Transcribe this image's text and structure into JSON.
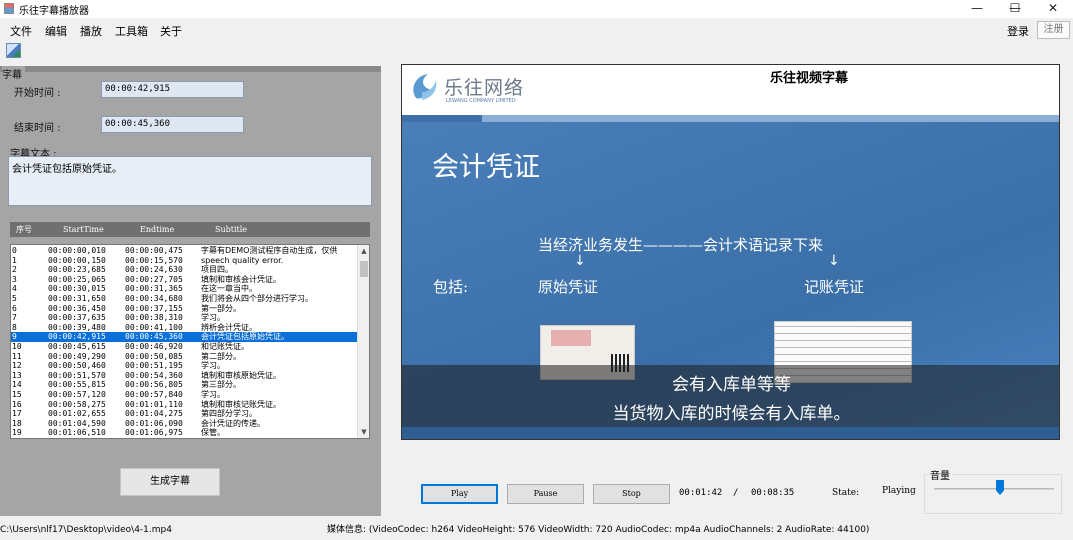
{
  "window": {
    "title": "乐往字幕播放器",
    "controls": [
      "—",
      "☐",
      "✕"
    ]
  },
  "menu": [
    "文件",
    "编辑",
    "播放",
    "工具箱",
    "关于"
  ],
  "auth": {
    "login": "登录",
    "register": "注册"
  },
  "subtitle_panel": {
    "group_label": "字幕",
    "start_label": "开始时间 :",
    "start_value": "00:00:42,915",
    "end_label": "结束时间 :",
    "end_value": "00:00:45,360",
    "text_label": "字幕文本 :",
    "text_value": "会计凭证包括原始凭证。"
  },
  "list": {
    "columns": [
      "序号",
      "StartTime",
      "Endtime",
      "Subtitle"
    ],
    "selected_index": 9,
    "rows": [
      [
        "0",
        "00:00:00,010",
        "00:00:00,475",
        "字幕有DEMO测试程序自动生成，仅供"
      ],
      [
        "1",
        "00:00:00,150",
        "00:00:15,570",
        "speech quality error."
      ],
      [
        "2",
        "00:00:23,685",
        "00:00:24,630",
        "项目四。"
      ],
      [
        "3",
        "00:00:25,065",
        "00:00:27,705",
        "填制和审核会计凭证。"
      ],
      [
        "4",
        "00:00:30,015",
        "00:00:31,365",
        "在这一章当中。"
      ],
      [
        "5",
        "00:00:31,650",
        "00:00:34,680",
        "我们将会从四个部分进行学习。"
      ],
      [
        "6",
        "00:00:36,450",
        "00:00:37,155",
        "第一部分。"
      ],
      [
        "7",
        "00:00:37,635",
        "00:00:38,310",
        "学习。"
      ],
      [
        "8",
        "00:00:39,480",
        "00:00:41,100",
        "辨析会计凭证。"
      ],
      [
        "9",
        "00:00:42,915",
        "00:00:45,360",
        "会计凭证包括原始凭证。"
      ],
      [
        "10",
        "00:00:45,615",
        "00:00:46,920",
        "和记账凭证。"
      ],
      [
        "11",
        "00:00:49,290",
        "00:00:50,085",
        "第二部分。"
      ],
      [
        "12",
        "00:00:50,460",
        "00:00:51,195",
        "学习。"
      ],
      [
        "13",
        "00:00:51,570",
        "00:00:54,360",
        "填制和审核原始凭证。"
      ],
      [
        "14",
        "00:00:55,815",
        "00:00:56,805",
        "第三部分。"
      ],
      [
        "15",
        "00:00:57,120",
        "00:00:57,840",
        "学习。"
      ],
      [
        "16",
        "00:00:58,275",
        "00:01:01,110",
        "填制和审核记账凭证。"
      ],
      [
        "17",
        "00:01:02,655",
        "00:01:04,275",
        "第四部分学习。"
      ],
      [
        "18",
        "00:01:04,590",
        "00:01:06,090",
        "会计凭证的传递。"
      ],
      [
        "19",
        "00:01:06,510",
        "00:01:06,975",
        "保管。"
      ]
    ]
  },
  "generate_button": "生成字幕",
  "video": {
    "logo_text": "乐往网络",
    "logo_sub": "LEWANG COMPANY LIMITED",
    "header": "乐往视频字幕",
    "slide_title": "会计凭证",
    "line1": "当经济业务发生————会计术语记录下来",
    "arrow": "↓",
    "includes": "包括:",
    "source_doc": "原始凭证",
    "accounting_doc": "记账凭证",
    "sub1": "会有入库单等等",
    "sub2": "当货物入库的时候会有入库单。"
  },
  "controls": {
    "play": "Play",
    "pause": "Pause",
    "stop": "Stop",
    "current_time": "00:01:42",
    "separator": "/",
    "total_time": "00:08:35",
    "state_label": "State:",
    "state_value": "Playing",
    "volume_label": "音量",
    "volume_level": 0.55
  },
  "status": {
    "path": "C:\\Users\\nlf17\\Desktop\\video\\4-1.mp4",
    "media_info": "媒体信息: (VideoCodec: h264 VideoHeight: 576 VideoWidth: 720 AudioCodec: mp4a AudioChannels: 2 AudioRate: 44100)"
  },
  "colors": {
    "selection": "#0a6fd6",
    "panel": "#a5a5a5",
    "slide_blue": "#4c7fb8"
  }
}
